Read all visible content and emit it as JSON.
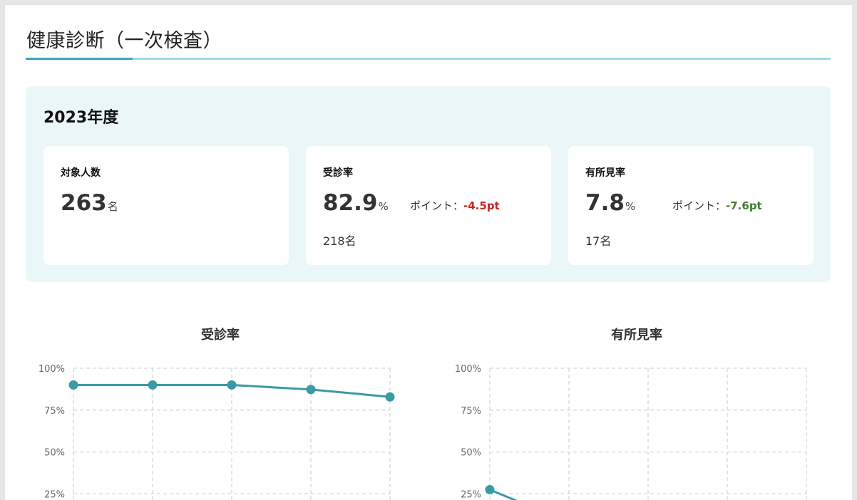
{
  "page": {
    "title": "健康診断（一次検査）"
  },
  "summary": {
    "year": "2023年度",
    "cards": [
      {
        "label": "対象人数",
        "value": "263",
        "unit": "名"
      },
      {
        "label": "受診率",
        "value": "82.9",
        "unit": "%",
        "point_label": "ポイント：",
        "point_delta": "-4.5pt",
        "sub": "218名"
      },
      {
        "label": "有所見率",
        "value": "7.8",
        "unit": "%",
        "point_label": "ポイント：",
        "point_delta": "-7.6pt",
        "sub": "17名"
      }
    ],
    "colors": {
      "delta_negative_bad": "#c0261f",
      "delta_negative_good": "#3f7f2f",
      "accent": "#3ba3c4"
    }
  },
  "chart_data": [
    {
      "type": "line",
      "title": "受診率",
      "xlabel": "",
      "ylabel": "",
      "yticks": [
        "25%",
        "50%",
        "75%",
        "100%"
      ],
      "ylim": [
        0,
        100
      ],
      "series": [
        {
          "values": [
            90,
            90,
            90,
            87.3,
            82.9
          ]
        }
      ],
      "grid": true,
      "color": "#3a9aa6"
    },
    {
      "type": "line",
      "title": "有所見率",
      "xlabel": "",
      "ylabel": "",
      "yticks": [
        "25%",
        "50%",
        "75%",
        "100%"
      ],
      "ylim": [
        0,
        100
      ],
      "series": [
        {
          "values": [
            27.5
          ]
        }
      ],
      "grid": true,
      "color": "#3a9aa6"
    }
  ]
}
